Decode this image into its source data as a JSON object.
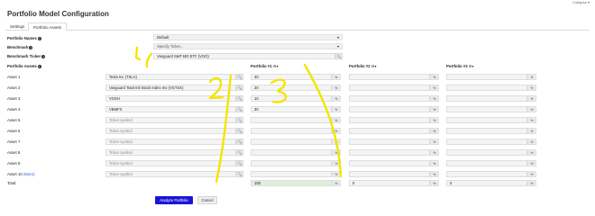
{
  "collapse_label": "Collapse",
  "page_title": "Portfolio Model Configuration",
  "tabs": [
    {
      "label": "Settings",
      "active": false
    },
    {
      "label": "Portfolio Assets",
      "active": true
    }
  ],
  "portfolio_names": {
    "label": "Portfolio Names",
    "value": "Default"
  },
  "benchmark": {
    "label": "Benchmark",
    "value": "Specify Ticker..."
  },
  "benchmark_ticker": {
    "label": "Benchmark Ticker",
    "value": "Vanguard S&P 500 ETF (VOO)"
  },
  "assets_label": "Portfolio Assets",
  "portfolio_headers": [
    "Portfolio #1",
    "Portfolio #2",
    "Portfolio #3"
  ],
  "ticker_placeholder": "Ticker symbol",
  "assets": [
    {
      "label": "Asset 1",
      "ticker": "Tesla Inc (TSLA)",
      "p1": "40"
    },
    {
      "label": "Asset 2",
      "ticker": "Vanguard Total Intl Stock Index Inv (VGTSX)",
      "p1": "20"
    },
    {
      "label": "Asset 3",
      "ticker": "VGSH",
      "p1": "10"
    },
    {
      "label": "Asset 4",
      "ticker": "VBMFX",
      "p1": "30"
    },
    {
      "label": "Asset 5",
      "ticker": "",
      "p1": ""
    },
    {
      "label": "Asset 6",
      "ticker": "",
      "p1": ""
    },
    {
      "label": "Asset 7",
      "ticker": "",
      "p1": ""
    },
    {
      "label": "Asset 8",
      "ticker": "",
      "p1": ""
    },
    {
      "label": "Asset 9",
      "ticker": "",
      "p1": ""
    },
    {
      "label": "Asset 10",
      "more": "(More)",
      "ticker": "",
      "p1": ""
    }
  ],
  "percent_symbol": "%",
  "search_symbol": "🔍",
  "gear_symbol": "⚙",
  "chevron_symbol": "▾",
  "total": {
    "label": "Total:",
    "values": [
      "100",
      "0",
      "0"
    ]
  },
  "buttons": {
    "analyze": "Analyze Portfolio",
    "cancel": "Cancel"
  },
  "colors": {
    "primary_button": "#1a14d6",
    "total_highlight": "#dff0d8",
    "annotation": "#f2e600"
  }
}
